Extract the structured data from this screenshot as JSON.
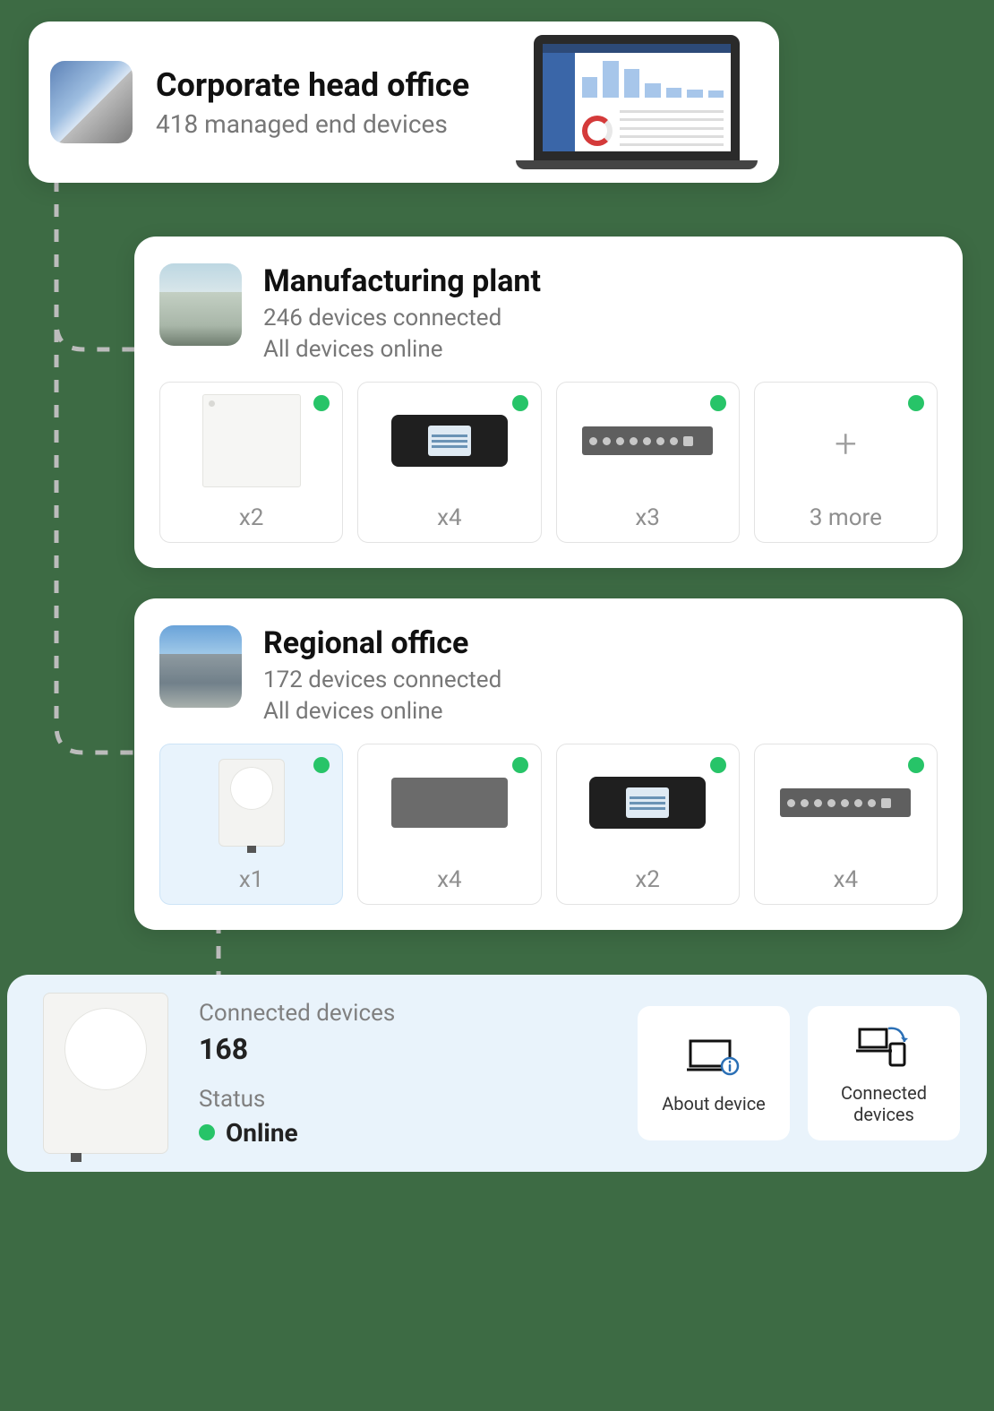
{
  "colors": {
    "online": "#27c468"
  },
  "head_office": {
    "title": "Corporate head office",
    "subtitle": "418 managed end devices"
  },
  "sites": [
    {
      "title": "Manufacturing plant",
      "line1": "246 devices connected",
      "line2": "All devices online",
      "tiles": [
        {
          "count": "x2"
        },
        {
          "count": "x4"
        },
        {
          "count": "x3"
        },
        {
          "more": "3 more"
        }
      ]
    },
    {
      "title": "Regional office",
      "line1": "172 devices connected",
      "line2": "All devices online",
      "tiles": [
        {
          "count": "x1",
          "selected": true
        },
        {
          "count": "x4"
        },
        {
          "count": "x2"
        },
        {
          "count": "x4"
        }
      ]
    }
  ],
  "detail": {
    "connected_label": "Connected devices",
    "connected_value": "168",
    "status_label": "Status",
    "status_value": "Online",
    "actions": {
      "about": "About device",
      "devices": "Connected devices"
    }
  }
}
